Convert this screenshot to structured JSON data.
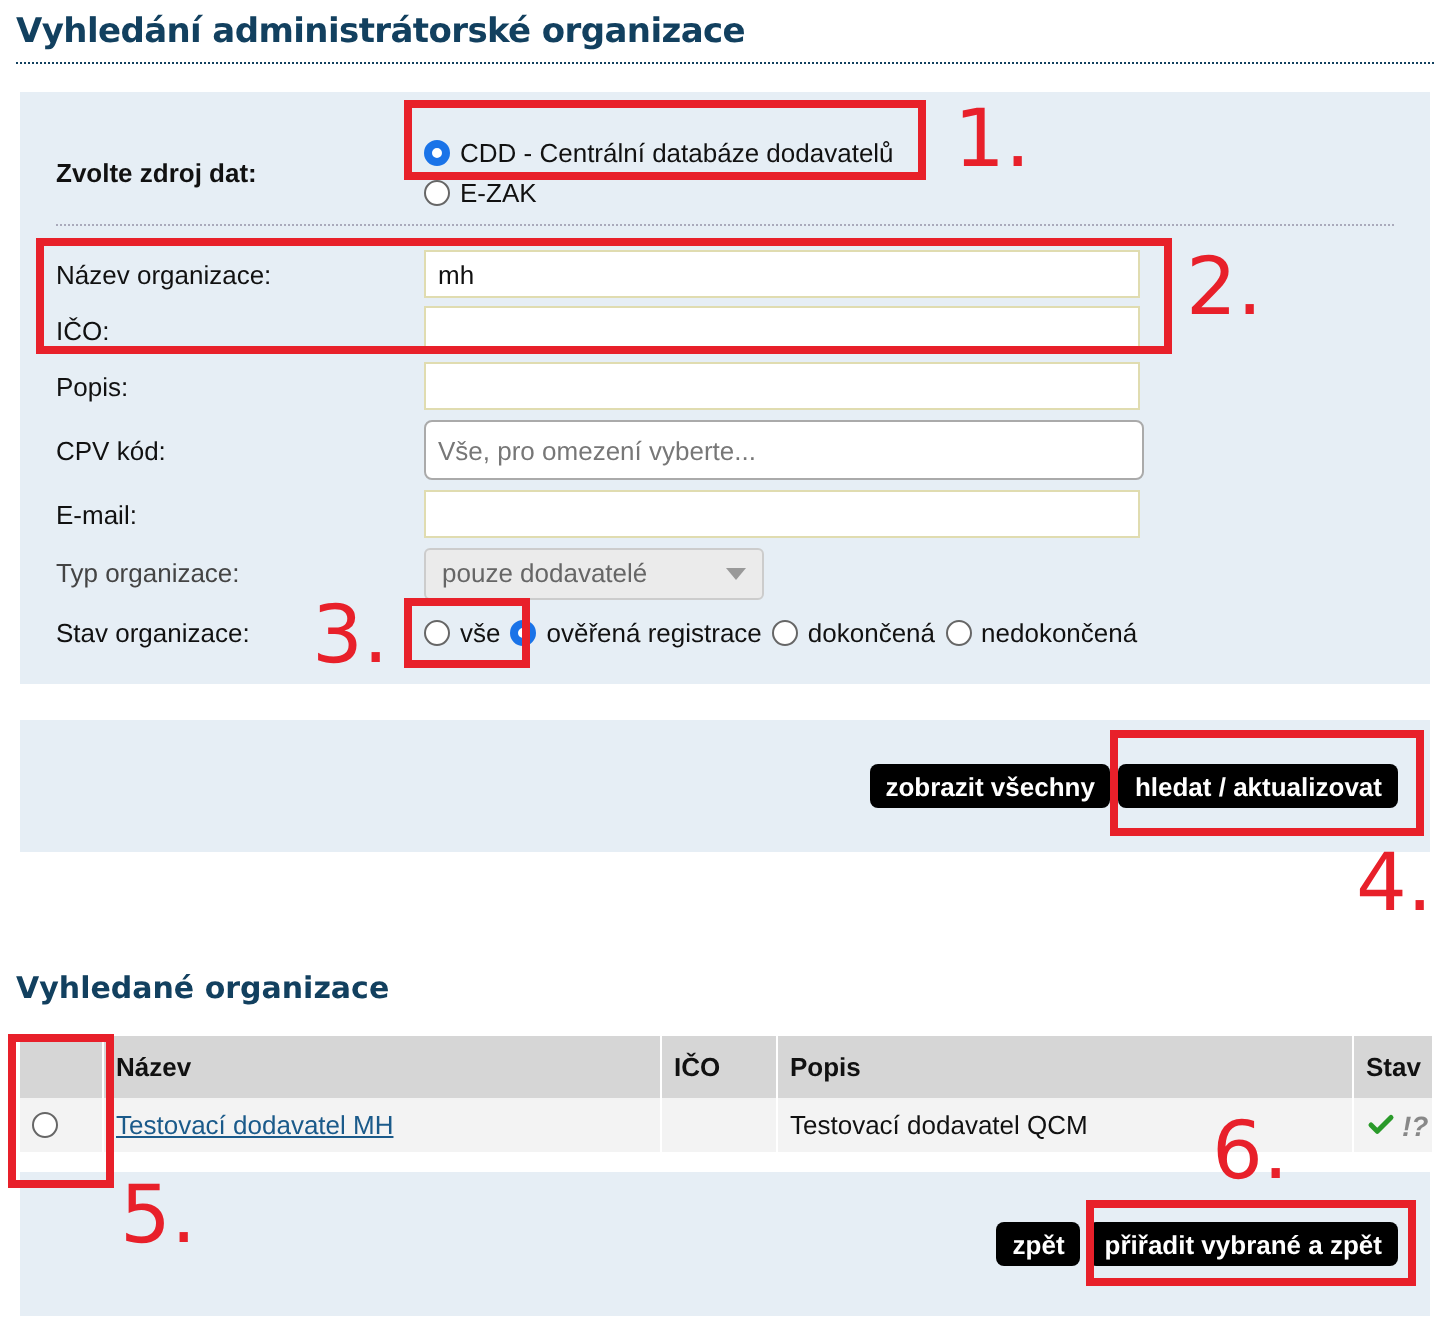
{
  "title": "Vyhledání administrátorské organizace",
  "source": {
    "label": "Zvolte zdroj dat:",
    "options": [
      {
        "label": "CDD - Centrální databáze dodavatelů",
        "selected": true
      },
      {
        "label": "E-ZAK",
        "selected": false
      }
    ]
  },
  "fields": [
    {
      "kind": "text",
      "label": "Název organizace:",
      "value": "mh"
    },
    {
      "kind": "text",
      "label": "IČO:"
    },
    {
      "kind": "text",
      "label": "Popis:"
    },
    {
      "kind": "lookup",
      "label": "CPV kód:",
      "placeholder": "Vše, pro omezení vyberte..."
    },
    {
      "kind": "text",
      "label": "E-mail:"
    },
    {
      "kind": "select",
      "label": "Typ organizace:",
      "value": "pouze dodavatelé",
      "disabled": true
    },
    {
      "kind": "radios",
      "label": "Stav organizace:",
      "options": [
        {
          "label": "vše",
          "selected": false
        },
        {
          "label": "ověřená registrace",
          "selected": true
        },
        {
          "label": "dokončená",
          "selected": false
        },
        {
          "label": "nedokončená",
          "selected": false
        }
      ]
    }
  ],
  "search_buttons": [
    "zobrazit všechny",
    "hledat / aktualizovat"
  ],
  "results": {
    "title": "Vyhledané organizace",
    "columns": [
      "Název",
      "IČO",
      "Popis",
      "Stav"
    ],
    "rows": [
      {
        "selected": false,
        "name": "Testovací dodavatel MH",
        "description": "Testovací dodavatel QCM",
        "verified": true,
        "status_mark": "!?"
      }
    ]
  },
  "result_buttons": [
    "zpět",
    "přiřadit vybrané a zpět"
  ],
  "annotations": [
    {
      "label": "1."
    },
    {
      "label": "2."
    },
    {
      "label": "3."
    },
    {
      "label": "4."
    },
    {
      "label": "5."
    },
    {
      "label": "6."
    }
  ]
}
